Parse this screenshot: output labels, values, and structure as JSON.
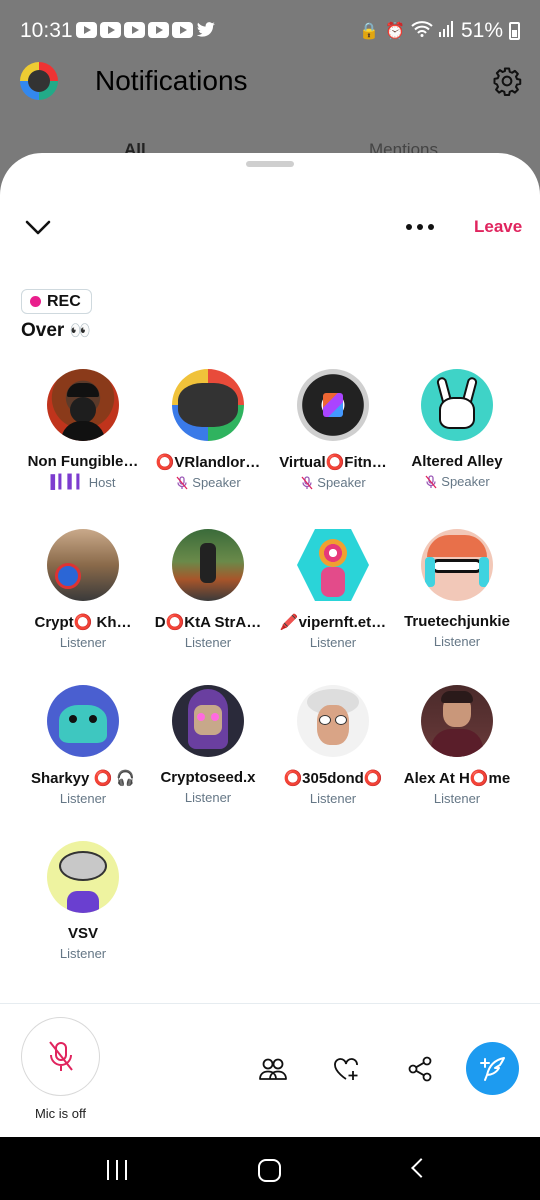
{
  "status_bar": {
    "time": "10:31",
    "battery": "51%"
  },
  "background": {
    "title": "Notifications",
    "tabs": [
      "All",
      "Mentions"
    ]
  },
  "space": {
    "leave_label": "Leave",
    "rec_label": "REC",
    "title": "Over",
    "title_emoji": "👀"
  },
  "participants": [
    {
      "name": "Non Fungible…",
      "role": "Host"
    },
    {
      "name": "⭕VRlandlor…",
      "role": "Speaker"
    },
    {
      "name": "Virtual⭕Fitn…",
      "role": "Speaker"
    },
    {
      "name": "Altered Alley",
      "role": "Speaker"
    },
    {
      "name": "Crypt⭕ Kh…",
      "role": "Listener"
    },
    {
      "name": "D⭕KtA StrA…",
      "role": "Listener"
    },
    {
      "name": "🖍️vipernft.et…",
      "role": "Listener"
    },
    {
      "name": "Truetechjunkie",
      "role": "Listener"
    },
    {
      "name": "Sharkyy ⭕ 🎧",
      "role": "Listener"
    },
    {
      "name": "Cryptoseed.x",
      "role": "Listener"
    },
    {
      "name": "⭕305dond⭕",
      "role": "Listener"
    },
    {
      "name": "Alex At H⭕me",
      "role": "Listener"
    },
    {
      "name": "VSV",
      "role": "Listener"
    }
  ],
  "controls": {
    "mic_label": "Mic is off"
  },
  "colors": {
    "accent": "#1d9bf0",
    "leave": "#e0245e",
    "rec_dot": "#e91e8c",
    "role_icon": "#7c3ccf"
  }
}
